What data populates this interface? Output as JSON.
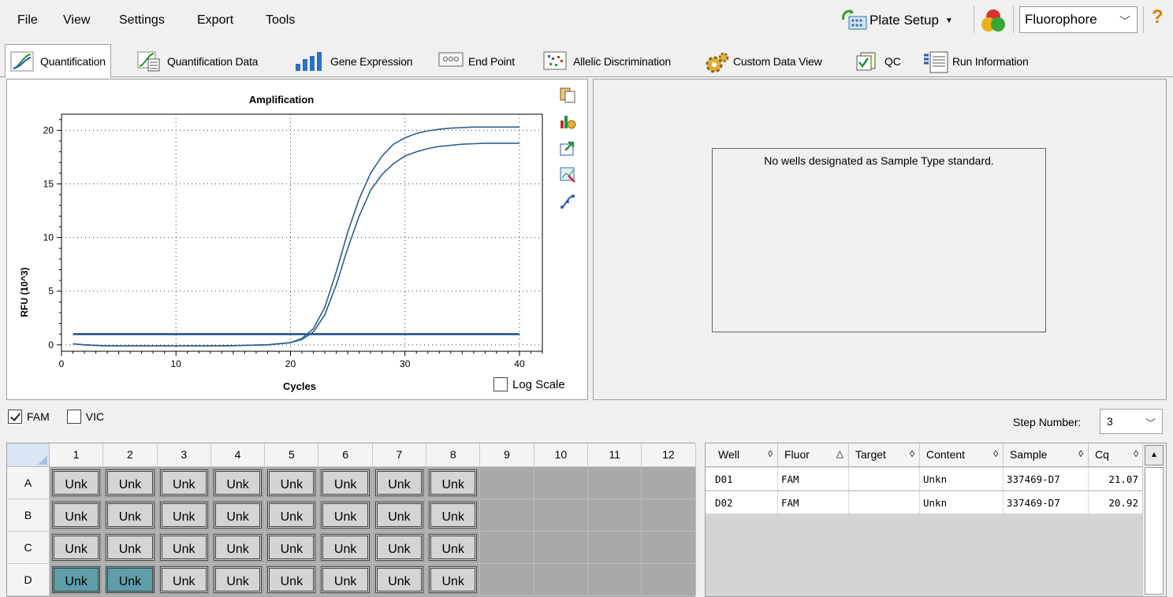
{
  "menu": [
    "File",
    "View",
    "Settings",
    "Export",
    "Tools"
  ],
  "toolbar": {
    "plate_setup": "Plate Setup",
    "fluorophore": "Fluorophore",
    "help": "?"
  },
  "tabs": [
    "Quantification",
    "Quantification Data",
    "Gene Expression",
    "End Point",
    "Allelic Discrimination",
    "Custom Data View",
    "QC",
    "Run Information"
  ],
  "chart": {
    "log_scale_label": "Log Scale",
    "log_scale_checked": false
  },
  "chart_data": {
    "type": "line",
    "title": "Amplification",
    "xlabel": "Cycles",
    "ylabel": "RFU (10^3)",
    "xlim": [
      0,
      42
    ],
    "ylim": [
      -0.6,
      21.5
    ],
    "xticks": [
      0,
      10,
      20,
      30,
      40
    ],
    "yticks": [
      0,
      5,
      10,
      15,
      20
    ],
    "grid": true,
    "series": [
      {
        "x": [
          1,
          2,
          4,
          6,
          8,
          10,
          12,
          14,
          16,
          18,
          20,
          21,
          22,
          23,
          24,
          25,
          26,
          27,
          28,
          29,
          30,
          31,
          32,
          33,
          34,
          35,
          36,
          37,
          38,
          39,
          40
        ],
        "y": [
          0.1,
          0.0,
          -0.1,
          -0.1,
          -0.1,
          -0.1,
          -0.1,
          -0.1,
          -0.05,
          0.0,
          0.2,
          0.5,
          1.2,
          2.8,
          5.6,
          9.0,
          12.0,
          14.4,
          15.9,
          16.9,
          17.6,
          18.0,
          18.3,
          18.5,
          18.6,
          18.7,
          18.75,
          18.8,
          18.8,
          18.8,
          18.8
        ]
      },
      {
        "x": [
          1,
          2,
          4,
          6,
          8,
          10,
          12,
          14,
          16,
          18,
          20,
          21,
          22,
          23,
          24,
          25,
          26,
          27,
          28,
          29,
          30,
          31,
          32,
          33,
          34,
          35,
          36,
          37,
          38,
          39,
          40
        ],
        "y": [
          0.1,
          0.0,
          -0.1,
          -0.1,
          -0.1,
          -0.1,
          -0.1,
          -0.1,
          -0.05,
          0.0,
          0.2,
          0.6,
          1.5,
          3.5,
          6.8,
          10.5,
          13.6,
          16.0,
          17.6,
          18.7,
          19.3,
          19.7,
          19.95,
          20.1,
          20.2,
          20.25,
          20.3,
          20.3,
          20.3,
          20.3,
          20.3
        ]
      }
    ],
    "threshold": 1.0
  },
  "standard_message": "No wells designated as Sample Type standard.",
  "filters": [
    {
      "label": "FAM",
      "checked": true
    },
    {
      "label": "VIC",
      "checked": false
    }
  ],
  "step": {
    "label": "Step Number:",
    "value": "3"
  },
  "plate": {
    "columns": [
      "1",
      "2",
      "3",
      "4",
      "5",
      "6",
      "7",
      "8",
      "9",
      "10",
      "11",
      "12"
    ],
    "rows": [
      "A",
      "B",
      "C",
      "D"
    ],
    "well_label": "Unk",
    "filled_columns": 8,
    "selected": [
      "D1",
      "D2"
    ]
  },
  "results": {
    "headers": [
      {
        "label": "Well",
        "sort": "◊"
      },
      {
        "label": "Fluor",
        "sort": "△"
      },
      {
        "label": "Target",
        "sort": "◊"
      },
      {
        "label": "Content",
        "sort": "◊"
      },
      {
        "label": "Sample",
        "sort": "◊"
      },
      {
        "label": "Cq",
        "sort": "◊"
      }
    ],
    "rows": [
      [
        "D01",
        "FAM",
        "",
        "Unkn",
        "337469-D7",
        "21.07"
      ],
      [
        "D02",
        "FAM",
        "",
        "Unkn",
        "337469-D7",
        "20.92"
      ]
    ]
  }
}
